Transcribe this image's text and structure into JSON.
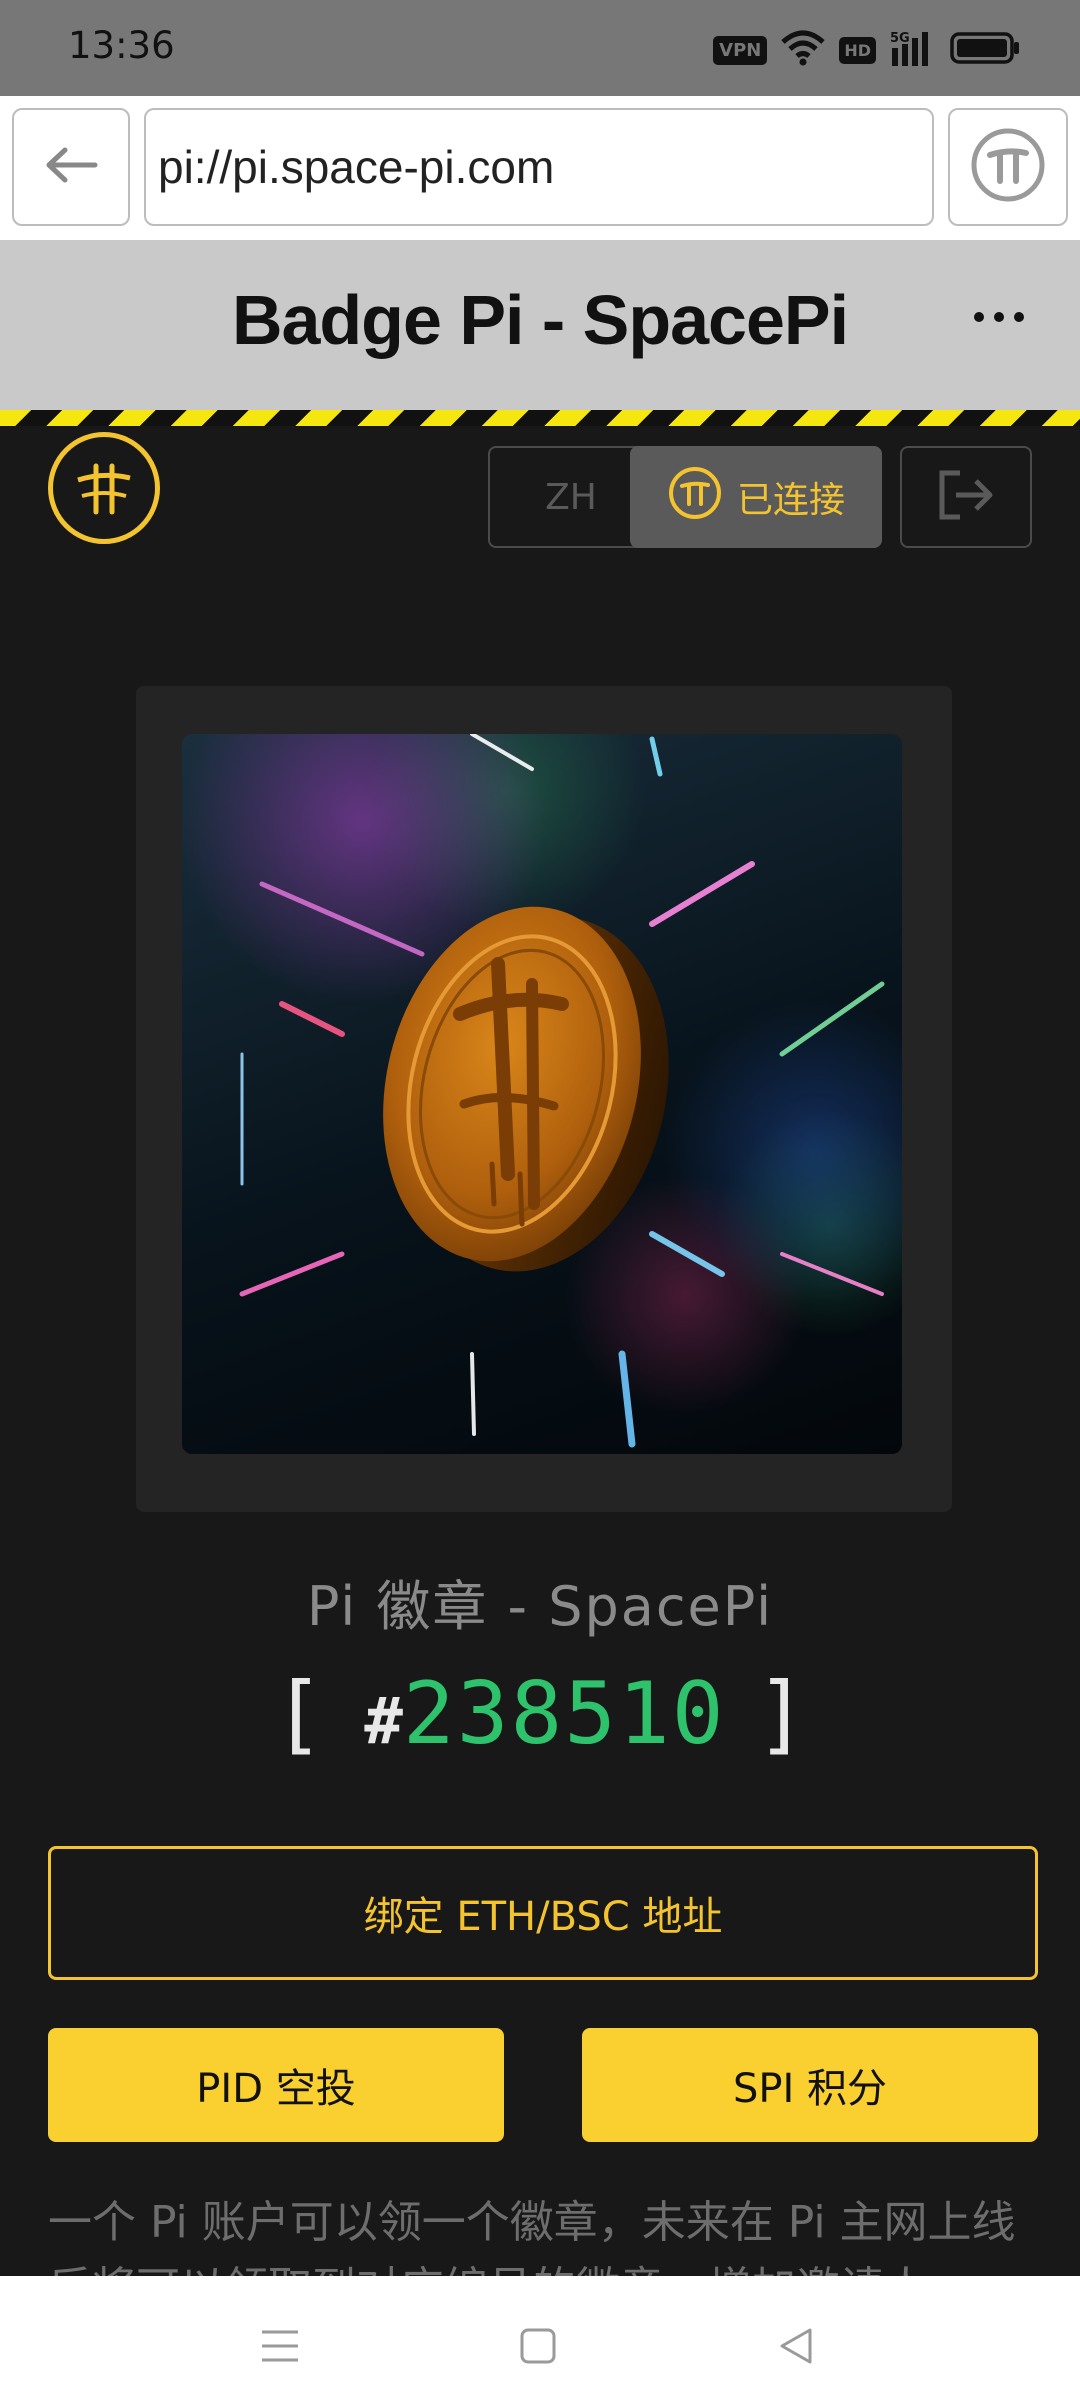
{
  "status_bar": {
    "time": "13:36",
    "icons": [
      "vpn-icon",
      "wifi-icon",
      "hd-icon",
      "5g-signal-icon",
      "battery-icon"
    ],
    "vpn_label": "VPN",
    "hd_label": "HD"
  },
  "browser": {
    "url": "pi://pi.space-pi.com",
    "back_icon": "back-arrow-icon",
    "pi_icon": "pi-icon"
  },
  "titlebar": {
    "title": "Badge Pi - SpacePi"
  },
  "header": {
    "language_label": "ZH",
    "connected_label": "已连接",
    "logout_icon": "logout-icon"
  },
  "badge": {
    "name": "Pi 徽章 - SpacePi",
    "bracket_open": "[",
    "hash": "#",
    "number": "238510",
    "bracket_close": "]"
  },
  "actions": {
    "bind_label": "绑定 ETH/BSC 地址",
    "pid_label": "PID 空投",
    "spi_label": "SPI 积分"
  },
  "description": "一个 Pi 账户可以领一个徽章，未来在 Pi 主网上线后将可以领取到对应编号的徽章，增加邀请人",
  "colors": {
    "accent": "#f4c330",
    "button_fill": "#f9d02f",
    "number_green": "#2dc26b",
    "background": "#181818"
  },
  "navbar": {
    "icons": [
      "menu-icon",
      "home-square-icon",
      "back-triangle-icon"
    ]
  }
}
